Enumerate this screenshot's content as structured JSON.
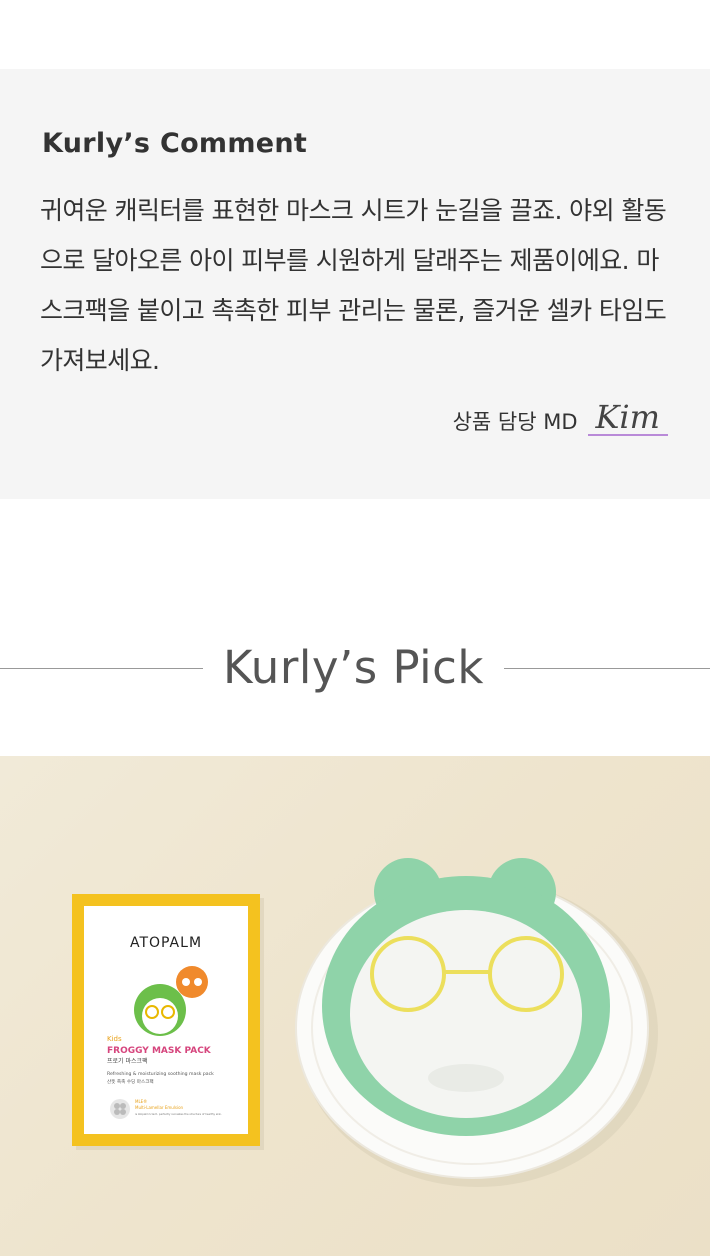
{
  "comment": {
    "title": "Kurly’s Comment",
    "body": "귀여운 캐릭터를 표현한 마스크 시트가 눈길을 끌죠. 야외 활동으로 달아오른 아이 피부를 시원하게 달래주는 제품이에요. 마스크팩을 붙이고 촉촉한 피부 관리는 물론, 즐거운 셀카 타임도 가져보세요.",
    "md_label": "상품 담당 MD",
    "md_name": "Kim"
  },
  "pick": {
    "title": "Kurly’s Pick"
  },
  "product_photo": {
    "package": {
      "brand": "ATOPALM",
      "kids": "Kids",
      "product_name": "FROGGY MASK PACK",
      "korean_name": "프로기 마스크팩",
      "description": "Refreshing & moisturizing soothing mask pack",
      "korean_description": "산뜻 촉촉 수딩 마스크팩",
      "mle_line": "MLE®",
      "mle_text": "Multi-Lamellar Emulsion",
      "small_print": "is Atopalm's tech. perfectly recreates the structure of healthy skin."
    },
    "colors": {
      "background": "#efe6d0",
      "package_yellow": "#f4c21f",
      "mask_green": "#8fd3a9",
      "pink": "#d6457d"
    }
  }
}
